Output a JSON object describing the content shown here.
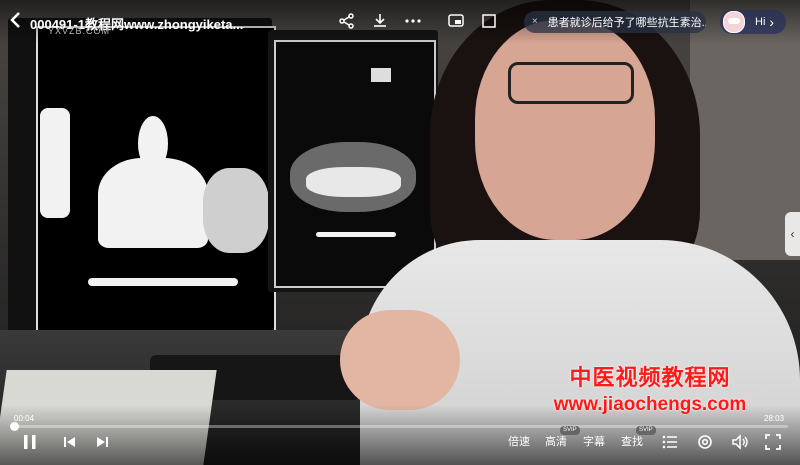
{
  "header": {
    "title": "000491-1教程网www.zhongyiketa...",
    "source_watermark": "YXVZB.COM",
    "icons": [
      "back-icon",
      "share-icon",
      "download-icon",
      "more-icon",
      "cast-icon",
      "pip-icon"
    ]
  },
  "danmaku": {
    "close_label": "×",
    "text": "患者就诊后给予了哪些抗生素治..."
  },
  "assistant": {
    "label": "Hi",
    "chevron": "›"
  },
  "side_handle": {
    "glyph": "‹"
  },
  "watermark": {
    "title": "中医视频教程网",
    "url": "www.jiaochengs.com",
    "color": "#ff1a1a"
  },
  "player": {
    "current_time": "00:04",
    "total_time": "28:03",
    "progress_fraction": 0.0024,
    "controls": {
      "speed_label": "倍速",
      "quality_label": "高清",
      "quality_badge": "SVIP",
      "subtitle_label": "字幕",
      "search_label": "查找",
      "search_badge": "SVIP"
    },
    "icons": [
      "pause-icon",
      "prev-icon",
      "next-icon",
      "playlist-icon",
      "settings-icon",
      "volume-icon",
      "fullscreen-icon"
    ]
  }
}
